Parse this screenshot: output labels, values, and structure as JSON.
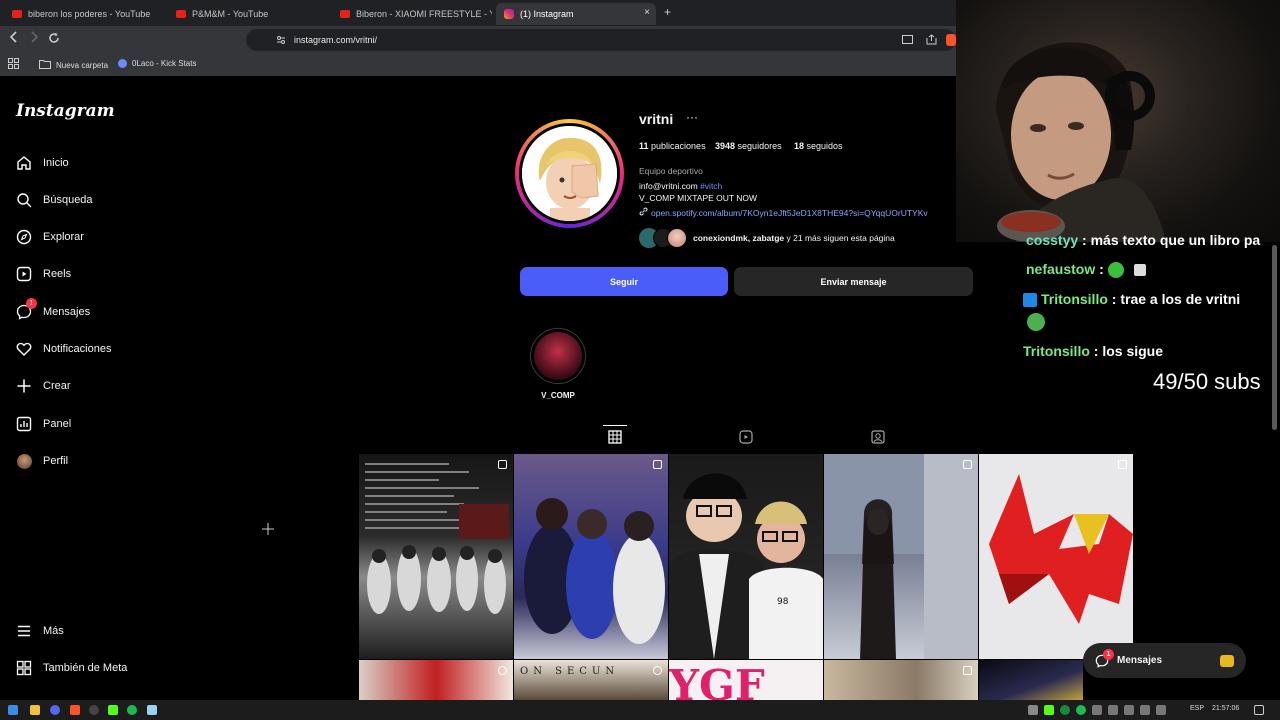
{
  "browser": {
    "tabs": [
      {
        "label": "biberon los poderes - YouTube",
        "icon": "youtube-icon"
      },
      {
        "label": "P&M&M - YouTube",
        "icon": "youtube-icon"
      },
      {
        "label": "Biberon - XIAOMI FREESTYLE - YouTu",
        "icon": "youtube-icon"
      },
      {
        "label": "(1) Instagram",
        "icon": "instagram-icon",
        "active": true
      }
    ],
    "new_tab": "+",
    "close": "×",
    "url": "instagram.com/vritni/",
    "bookmarks": [
      {
        "label": "Nueva carpeta",
        "icon": "folder-icon"
      },
      {
        "label": "0Laco - Kick Stats",
        "icon": "kick-icon"
      }
    ]
  },
  "instagram": {
    "logo": "Instagram",
    "nav": [
      {
        "label": "Inicio",
        "icon": "home-icon"
      },
      {
        "label": "Búsqueda",
        "icon": "search-icon"
      },
      {
        "label": "Explorar",
        "icon": "compass-icon"
      },
      {
        "label": "Reels",
        "icon": "reels-icon"
      },
      {
        "label": "Mensajes",
        "icon": "messenger-icon",
        "badge": "1"
      },
      {
        "label": "Notificaciones",
        "icon": "heart-icon"
      },
      {
        "label": "Crear",
        "icon": "plus-icon"
      },
      {
        "label": "Panel",
        "icon": "panel-icon"
      },
      {
        "label": "Perfil",
        "icon": "avatar-icon"
      }
    ],
    "bottom_nav": [
      {
        "label": "Más",
        "icon": "menu-icon"
      },
      {
        "label": "También de Meta",
        "icon": "meta-icon"
      }
    ],
    "profile": {
      "username": "vritni",
      "more": "···",
      "posts_count": "11",
      "posts_label": "publicaciones",
      "followers_count": "3948",
      "followers_label": "seguidores",
      "following_count": "18",
      "following_label": "seguidos",
      "category": "Equipo deportivo",
      "email": "info@vritni.com",
      "hashtag": "#vitch",
      "bio": "V_COMP MIXTAPE OUT NOW",
      "link": "open.spotify.com/album/7KOyn1eJft5JeD1X8THE94?si=QYqqUOrUTYKv",
      "followed_by_names": "conexiondmk, zabatge",
      "followed_by_rest": " y 21 más siguen esta página",
      "follow_button": "Seguir",
      "message_button": "Enviar mensaje",
      "highlight_label": "V_COMP"
    },
    "messages_pill": {
      "label": "Mensajes",
      "badge": "1"
    }
  },
  "overlay": {
    "chat": [
      {
        "user": "cosstyy",
        "text": " : más texto que un libro pa",
        "user_color": "#6fe3c1"
      },
      {
        "user": "nefaustow",
        "text": " : ",
        "user_color": "#7ee787"
      },
      {
        "user": "Tritonsillo",
        "text": " : trae a los de vritni",
        "user_color": "#7ee787"
      },
      {
        "user": "Tritonsillo",
        "text": " : los sigue",
        "user_color": "#7ee787"
      }
    ],
    "subs": "49/50 subs"
  },
  "taskbar": {
    "lang": "ESP",
    "time": "21:57:06"
  },
  "colors": {
    "follow_blue": "#4a5df9",
    "badge_red": "#ff3040",
    "link_blue": "#e0f1ff"
  }
}
